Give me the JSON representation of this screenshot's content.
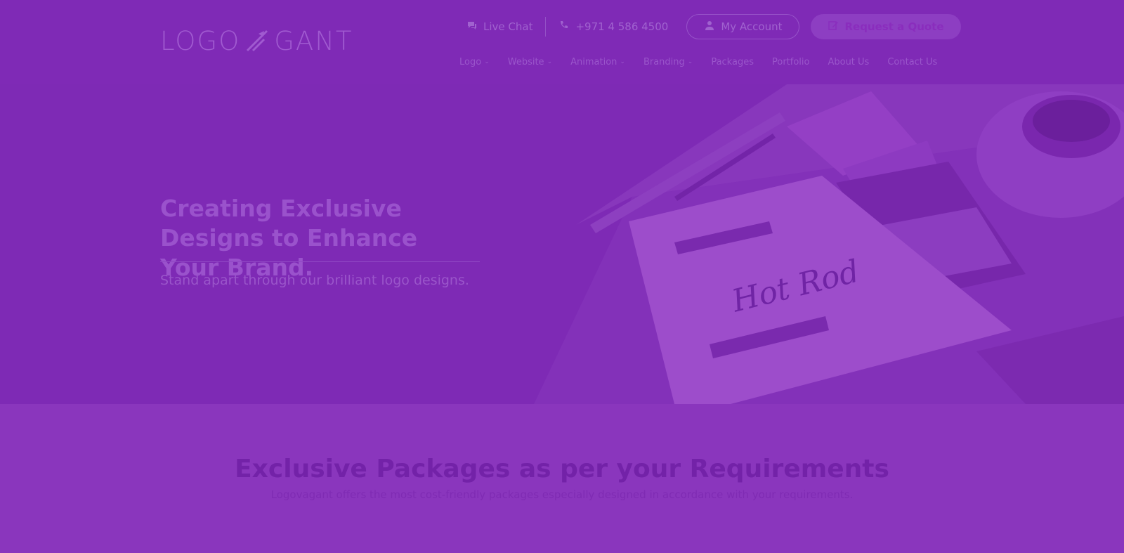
{
  "brand": {
    "logo_left": "LOGO",
    "logo_right": "GANT"
  },
  "topbar": {
    "live_chat": "Live Chat",
    "phone": "+971 4 586 4500",
    "my_account": "My Account",
    "request_quote": "Request a Quote"
  },
  "nav": {
    "items": [
      {
        "label": "Logo",
        "has_dropdown": true
      },
      {
        "label": "Website",
        "has_dropdown": true
      },
      {
        "label": "Animation",
        "has_dropdown": true
      },
      {
        "label": "Branding",
        "has_dropdown": true
      },
      {
        "label": "Packages",
        "has_dropdown": false
      },
      {
        "label": "Portfolio",
        "has_dropdown": false
      },
      {
        "label": "About Us",
        "has_dropdown": false
      },
      {
        "label": "Contact Us",
        "has_dropdown": false
      }
    ],
    "chevron": "⌄"
  },
  "hero": {
    "title": "Creating Exclusive Designs to Enhance Your Brand.",
    "subtitle": "Stand apart through our brilliant logo designs.",
    "sketch_text": "Hot Rod"
  },
  "packages": {
    "title": "Exclusive Packages as per your Requirements",
    "subtitle": "Logovagant offers the most cost-friendly packages especially designed in accordance with your requirements."
  },
  "colors": {
    "overlay": "#7e2ab5",
    "section_bg": "#8a36bd",
    "muted_text": "#9a55cb",
    "heading_dark": "#7322a8"
  }
}
